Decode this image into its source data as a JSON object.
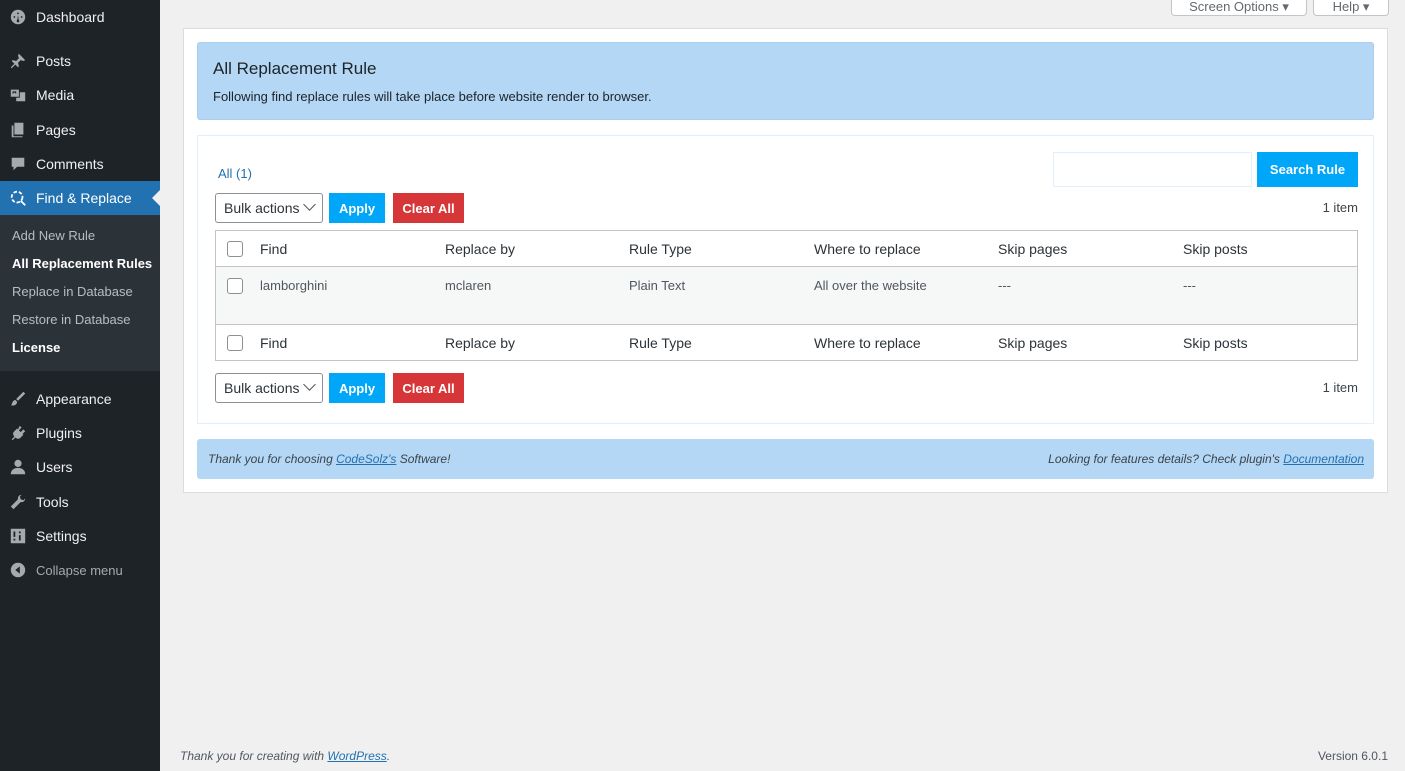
{
  "sidebar": {
    "items": [
      {
        "label": "Dashboard",
        "icon": "dashboard-icon"
      },
      {
        "label": "Posts",
        "icon": "pin-icon"
      },
      {
        "label": "Media",
        "icon": "media-icon"
      },
      {
        "label": "Pages",
        "icon": "pages-icon"
      },
      {
        "label": "Comments",
        "icon": "comment-icon"
      },
      {
        "label": "Find & Replace",
        "icon": "find-replace-icon"
      },
      {
        "label": "Appearance",
        "icon": "brush-icon"
      },
      {
        "label": "Plugins",
        "icon": "plug-icon"
      },
      {
        "label": "Users",
        "icon": "user-icon"
      },
      {
        "label": "Tools",
        "icon": "wrench-icon"
      },
      {
        "label": "Settings",
        "icon": "settings-icon"
      }
    ],
    "submenu": [
      "Add New Rule",
      "All Replacement Rules",
      "Replace in Database",
      "Restore in Database",
      "License"
    ],
    "collapse_label": "Collapse menu"
  },
  "top": {
    "screen_options": "Screen Options ▾",
    "help": "Help ▾"
  },
  "header": {
    "title": "All Replacement Rule",
    "subtitle": "Following find replace rules will take place before website render to browser."
  },
  "list": {
    "filter_all": "All (1)",
    "search_placeholder": "",
    "search_button": "Search Rule",
    "bulk_actions": "Bulk actions",
    "apply": "Apply",
    "clear_all": "Clear All",
    "count": "1 item",
    "columns": [
      "Find",
      "Replace by",
      "Rule Type",
      "Where to replace",
      "Skip pages",
      "Skip posts"
    ],
    "rows": [
      [
        "lamborghini",
        "mclaren",
        "Plain Text",
        "All over the website",
        "---",
        "---"
      ]
    ]
  },
  "footer_box": {
    "left_prefix": "Thank you for choosing ",
    "left_link": "CodeSolz's",
    "left_suffix": " Software!",
    "right_prefix": "Looking for features details? Check plugin's ",
    "right_link": "Documentation"
  },
  "wp_footer": {
    "left_prefix": "Thank you for creating with ",
    "left_link": "WordPress",
    "left_suffix": ".",
    "version": "Version 6.0.1"
  },
  "colors": {
    "sidebar_bg": "#1d2327",
    "current_menu": "#2271b1",
    "header_box": "#b3d7f5",
    "apply_button": "#00a6f7",
    "clear_button": "#d63638"
  }
}
